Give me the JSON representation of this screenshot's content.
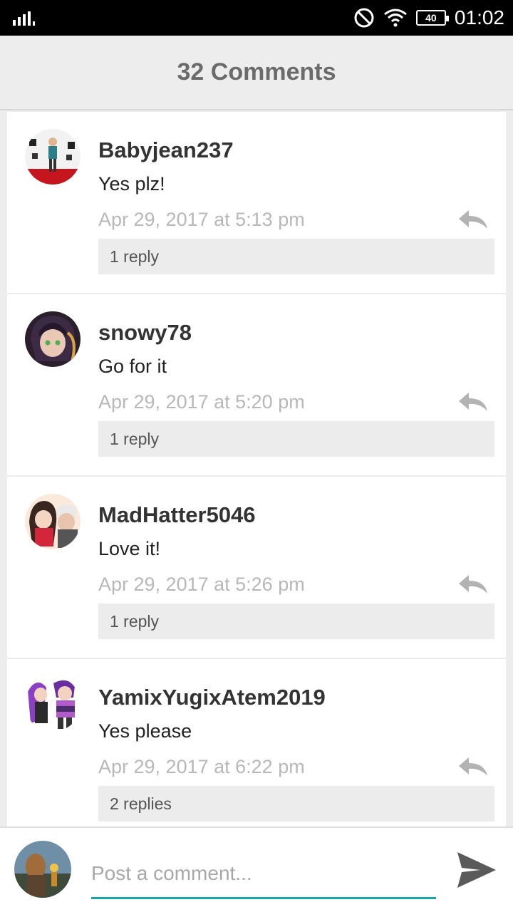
{
  "status_bar": {
    "time": "01:02",
    "battery": "40",
    "icons": [
      "signal-icon",
      "do-not-disturb-icon",
      "wifi-icon",
      "battery-icon"
    ]
  },
  "header": {
    "title": "32 Comments"
  },
  "comments": [
    {
      "username": "Babyjean237",
      "text": "Yes plz!",
      "time": "Apr 29, 2017 at 5:13 pm",
      "replies": "1 reply"
    },
    {
      "username": "snowy78",
      "text": "Go for it",
      "time": "Apr 29, 2017 at 5:20 pm",
      "replies": "1 reply"
    },
    {
      "username": "MadHatter5046",
      "text": "Love it!",
      "time": "Apr 29, 2017 at 5:26 pm",
      "replies": "1 reply"
    },
    {
      "username": "YamixYugixAtem2019",
      "text": "Yes please",
      "time": "Apr 29, 2017 at 6:22 pm",
      "replies": "2 replies"
    }
  ],
  "composer": {
    "placeholder": "Post a comment..."
  },
  "colors": {
    "accent": "#1aa5a5",
    "header_bg": "#ededed",
    "muted": "#b8b8b8"
  }
}
